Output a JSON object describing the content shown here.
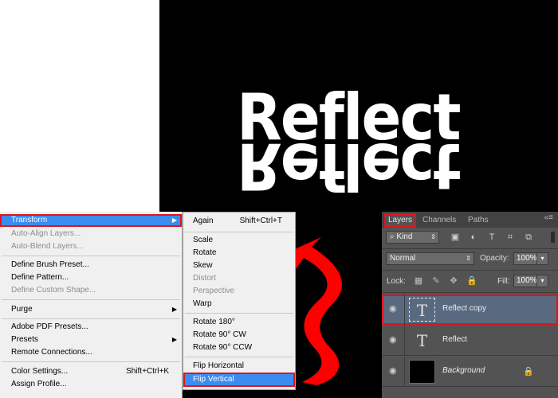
{
  "canvas": {
    "text": "Reflect",
    "mirror_text": "Reflect",
    "background": "#000000",
    "arrow_color": "#ff0000"
  },
  "menu": {
    "items": [
      {
        "label": "Transform",
        "submenu": true,
        "highlighted": true
      },
      {
        "label": "Auto-Align Layers...",
        "disabled": true
      },
      {
        "label": "Auto-Blend Layers...",
        "disabled": true
      },
      {
        "label": "Define Brush Preset..."
      },
      {
        "label": "Define Pattern..."
      },
      {
        "label": "Define Custom Shape...",
        "disabled": true
      },
      {
        "label": "Purge",
        "submenu": true
      },
      {
        "label": "Adobe PDF Presets..."
      },
      {
        "label": "Presets",
        "submenu": true
      },
      {
        "label": "Remote Connections..."
      },
      {
        "label": "Color Settings...",
        "shortcut": "Shift+Ctrl+K"
      },
      {
        "label": "Assign Profile..."
      }
    ]
  },
  "submenu": {
    "items": [
      {
        "label": "Again",
        "shortcut": "Shift+Ctrl+T"
      },
      {
        "label": "Scale"
      },
      {
        "label": "Rotate"
      },
      {
        "label": "Skew"
      },
      {
        "label": "Distort",
        "disabled": true
      },
      {
        "label": "Perspective",
        "disabled": true
      },
      {
        "label": "Warp"
      },
      {
        "label": "Rotate 180°"
      },
      {
        "label": "Rotate 90° CW"
      },
      {
        "label": "Rotate 90° CCW"
      },
      {
        "label": "Flip Horizontal"
      },
      {
        "label": "Flip Vertical",
        "highlighted": true
      }
    ]
  },
  "layers_panel": {
    "tabs": [
      "Layers",
      "Channels",
      "Paths"
    ],
    "active_tab": "Layers",
    "filter_kind": "Kind",
    "blend_mode": "Normal",
    "opacity_label": "Opacity:",
    "opacity_value": "100%",
    "lock_label": "Lock:",
    "fill_label": "Fill:",
    "fill_value": "100%",
    "layers": [
      {
        "name": "Reflect copy",
        "type": "text",
        "selected": true
      },
      {
        "name": "Reflect",
        "type": "text"
      },
      {
        "name": "Background",
        "type": "background",
        "locked": true
      }
    ],
    "colors": {
      "selection_outline": "#e0141b",
      "selected_layer": "#596a80",
      "menu_highlight": "#3b8cf0"
    }
  }
}
